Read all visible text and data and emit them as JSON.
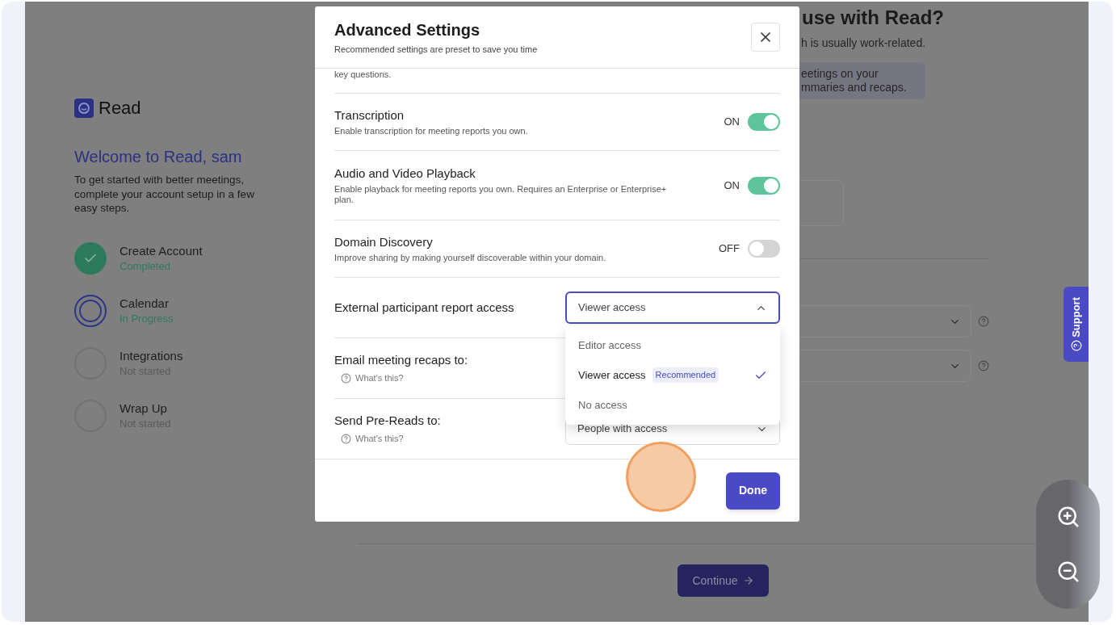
{
  "sidebar": {
    "logo": "Read",
    "welcome": "Welcome to Read, sam",
    "intro": "To get started with better meetings, complete your account setup in a few easy steps.",
    "steps": [
      {
        "title": "Create Account",
        "status": "Completed",
        "kind": "done"
      },
      {
        "title": "Calendar",
        "status": "In Progress",
        "kind": "current"
      },
      {
        "title": "Integrations",
        "status": "Not started",
        "kind": "todo"
      },
      {
        "title": "Wrap Up",
        "status": "Not started",
        "kind": "todo"
      }
    ]
  },
  "page": {
    "title": "use with Read?",
    "subtitle": "h is usually work-related.",
    "note_lines": [
      "eetings on your",
      "mmaries and recaps."
    ],
    "continue_button": "Continue"
  },
  "support_tab": "Support",
  "dialog": {
    "title": "Advanced Settings",
    "subtitle": "Recommended settings are preset to save you time",
    "cut_text": "key questions.",
    "rows": [
      {
        "kind": "toggle",
        "label": "Transcription",
        "description": "Enable transcription for meeting reports you own.",
        "state_text": "ON",
        "on": true
      },
      {
        "kind": "toggle",
        "label": "Audio and Video Playback",
        "description": "Enable playback for meeting reports you own. Requires an Enterprise or Enterprise+ plan.",
        "state_text": "ON",
        "on": true
      },
      {
        "kind": "toggle",
        "label": "Domain Discovery",
        "description": "Improve sharing by making yourself discoverable within your domain.",
        "state_text": "OFF",
        "on": false
      },
      {
        "kind": "select",
        "label": "External participant report access",
        "value": "Viewer access",
        "expanded": true,
        "options": [
          {
            "label": "Editor access",
            "selected": false
          },
          {
            "label": "Viewer access",
            "badge": "Recommended",
            "selected": true
          },
          {
            "label": "No access",
            "selected": false
          }
        ]
      },
      {
        "kind": "select",
        "label": "Email meeting recaps to:",
        "help": "What's this?"
      },
      {
        "kind": "select",
        "label": "Send Pre-Reads to:",
        "help": "What's this?",
        "value": "People with access",
        "expanded": false
      }
    ],
    "done_button": "Done"
  }
}
